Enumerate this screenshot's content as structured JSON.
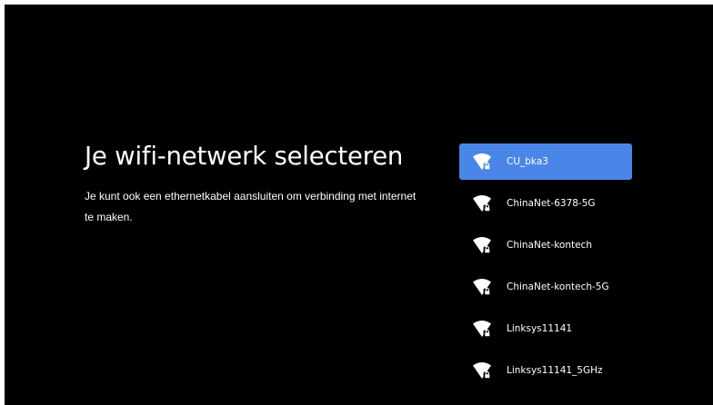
{
  "page": {
    "title": "Je wifi-netwerk selecteren",
    "description": "Je kunt ook een ethernetkabel aansluiten om verbinding met internet te maken."
  },
  "colors": {
    "background": "#000000",
    "text": "#ffffff",
    "selected_highlight": "#4a86e8"
  },
  "networks": [
    {
      "name": "CU_bka3",
      "icon": "wifi-locked-icon",
      "selected": true
    },
    {
      "name": "ChinaNet-6378-5G",
      "icon": "wifi-locked-icon",
      "selected": false
    },
    {
      "name": "ChinaNet-kontech",
      "icon": "wifi-locked-icon",
      "selected": false
    },
    {
      "name": "ChinaNet-kontech-5G",
      "icon": "wifi-locked-icon",
      "selected": false
    },
    {
      "name": "Linksys11141",
      "icon": "wifi-locked-icon",
      "selected": false
    },
    {
      "name": "Linksys11141_5GHz",
      "icon": "wifi-locked-icon",
      "selected": false
    }
  ]
}
